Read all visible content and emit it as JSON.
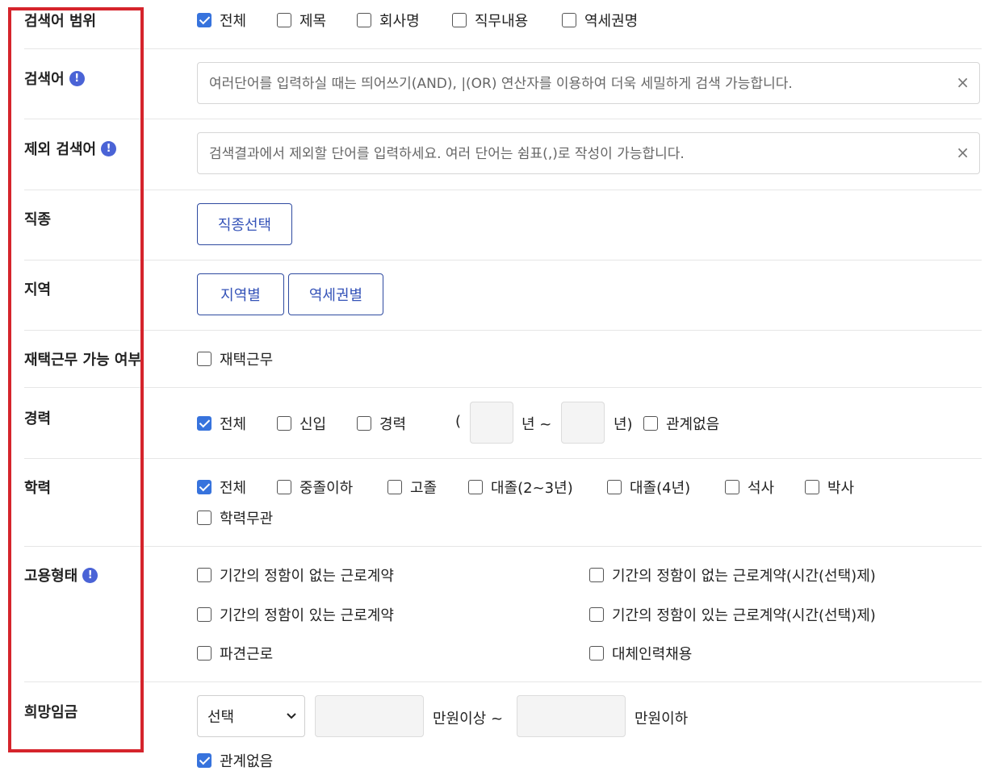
{
  "search_scope": {
    "label": "검색어 범위",
    "options": [
      {
        "label": "전체",
        "checked": true
      },
      {
        "label": "제목",
        "checked": false
      },
      {
        "label": "회사명",
        "checked": false
      },
      {
        "label": "직무내용",
        "checked": false
      },
      {
        "label": "역세권명",
        "checked": false
      }
    ]
  },
  "keyword": {
    "label": "검색어",
    "value": "",
    "placeholder": "여러단어를 입력하실 때는 띄어쓰기(AND), |(OR) 연산자를 이용하여 더욱 세밀하게 검색 가능합니다.",
    "clear_symbol": "×"
  },
  "exclude_keyword": {
    "label": "제외 검색어",
    "value": "",
    "placeholder": "검색결과에서 제외할 단어를 입력하세요. 여러 단어는 쉼표(,)로 작성이 가능합니다.",
    "clear_symbol": "×"
  },
  "info_symbol": "!",
  "job_type": {
    "label": "직종",
    "button": "직종선택"
  },
  "region": {
    "label": "지역",
    "buttons": [
      "지역별",
      "역세권별"
    ]
  },
  "remote": {
    "label": "재택근무 가능 여부",
    "option": {
      "label": "재택근무",
      "checked": false
    }
  },
  "career": {
    "label": "경력",
    "options": [
      {
        "label": "전체",
        "checked": true
      },
      {
        "label": "신입",
        "checked": false
      },
      {
        "label": "경력",
        "checked": false
      }
    ],
    "open_paren": "(",
    "from_value": "",
    "year_from_suffix": "년 ~",
    "to_value": "",
    "year_to_suffix": "년)",
    "any": {
      "label": "관계없음",
      "checked": false
    }
  },
  "education": {
    "label": "학력",
    "options": [
      {
        "label": "전체",
        "checked": true
      },
      {
        "label": "중졸이하",
        "checked": false
      },
      {
        "label": "고졸",
        "checked": false
      },
      {
        "label": "대졸(2~3년)",
        "checked": false
      },
      {
        "label": "대졸(4년)",
        "checked": false
      },
      {
        "label": "석사",
        "checked": false
      },
      {
        "label": "박사",
        "checked": false
      },
      {
        "label": "학력무관",
        "checked": false
      }
    ]
  },
  "employment_type": {
    "label": "고용형태",
    "options": [
      {
        "label": "기간의 정함이 없는 근로계약",
        "checked": false
      },
      {
        "label": "기간의 정함이 없는 근로계약(시간(선택)제)",
        "checked": false
      },
      {
        "label": "기간의 정함이 있는 근로계약",
        "checked": false
      },
      {
        "label": "기간의 정함이 있는 근로계약(시간(선택)제)",
        "checked": false
      },
      {
        "label": "파견근로",
        "checked": false
      },
      {
        "label": "대체인력채용",
        "checked": false
      }
    ]
  },
  "salary": {
    "label": "희망임금",
    "select_value": "선택",
    "min_value": "",
    "min_suffix": "만원이상 ~",
    "max_value": "",
    "max_suffix": "만원이하",
    "any": {
      "label": "관계없음",
      "checked": true
    }
  },
  "colors": {
    "accent": "#3773dd",
    "button_text": "#3553b8",
    "highlight": "#d5242c"
  }
}
